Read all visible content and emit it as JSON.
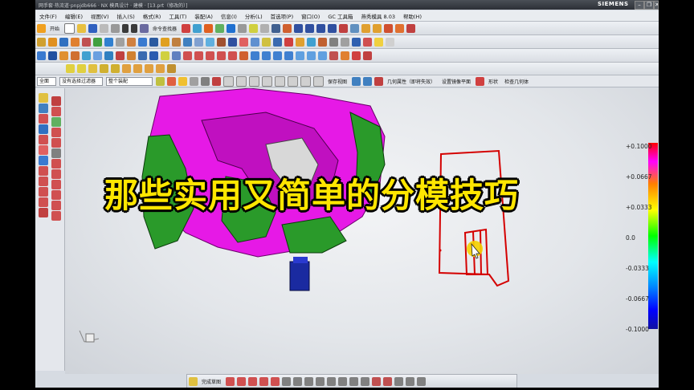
{
  "window": {
    "title": "网手套·热流道·pnpjdb666 · NX 模具设计 · 建模 · [13.prt（修改的）]",
    "brand": "SIEMENS",
    "controls": [
      "–",
      "❐",
      "✕"
    ]
  },
  "menubar": [
    "文件(F)",
    "编辑(E)",
    "视图(V)",
    "插入(S)",
    "格式(R)",
    "工具(T)",
    "装配(A)",
    "信息(I)",
    "分析(L)",
    "首选项(P)",
    "窗口(O)",
    "GC 工具箱",
    "燕秀模具 8.03",
    "帮助(H)"
  ],
  "toolbar_row1": {
    "start_label": "开始",
    "command_finder_label": "命令查找器"
  },
  "selection_bar": {
    "filter_value": "全面",
    "type_filter": "没有选择过滤器",
    "scope_value": "整个装配",
    "save_view": "保存视图",
    "geometry_attr": "几何属性（即将失效）",
    "mirror_plane": "设置镜像平面",
    "shape_label": "形状",
    "check_geometry": "检查几何体"
  },
  "bottom_toolbar": {
    "sketch_label": "完成草图"
  },
  "overlay": {
    "title": "那些实用又简单的分模技巧"
  },
  "legend": {
    "labels": [
      "+0.1000",
      "+0.0667",
      "+0.0333",
      "0.0",
      "-0.0333",
      "-0.0667",
      "-0.1000"
    ]
  },
  "colors": {
    "model_magenta": "#e619e6",
    "model_green": "#2a9a2a",
    "model_blue": "#1a2aa0",
    "sketch_red": "#d40000",
    "title_yellow": "#ffe600"
  }
}
